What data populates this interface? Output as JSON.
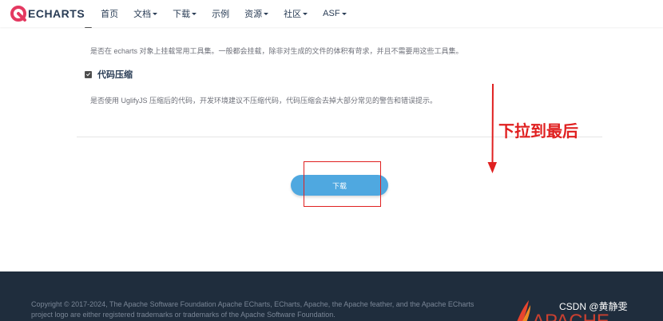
{
  "nav": {
    "logo_text": "ECHARTS",
    "items": [
      {
        "label": "首页",
        "has_dropdown": false
      },
      {
        "label": "文档",
        "has_dropdown": true
      },
      {
        "label": "下载",
        "has_dropdown": true
      },
      {
        "label": "示例",
        "has_dropdown": false
      },
      {
        "label": "资源",
        "has_dropdown": true
      },
      {
        "label": "社区",
        "has_dropdown": true
      },
      {
        "label": "ASF",
        "has_dropdown": true
      }
    ]
  },
  "options": {
    "toolbox_desc": "是否在 echarts 对象上挂载常用工具集。一般都会挂载，除非对生成的文件的体积有苛求，并且不需要用这些工具集。",
    "minify_title": "代码压缩",
    "minify_checked": true,
    "minify_desc": "是否使用 UglifyJS 压缩后的代码，开发环境建议不压缩代码，代码压缩会去掉大部分常见的警告和错误提示。"
  },
  "download": {
    "label": "下载"
  },
  "annotation": {
    "text": "下拉到最后"
  },
  "footer": {
    "copyright": "Copyright © 2017-2024, The Apache Software Foundation Apache ECharts, ECharts, Apache, the Apache feather, and the Apache ECharts project logo are either registered trademarks or trademarks of the Apache Software Foundation.",
    "watermark": "CSDN @黄静雯"
  },
  "colors": {
    "brand_blue": "#4fa8e0",
    "annotation_red": "#e02020",
    "footer_bg": "#1f2d3d",
    "logo_red": "#e43961"
  }
}
